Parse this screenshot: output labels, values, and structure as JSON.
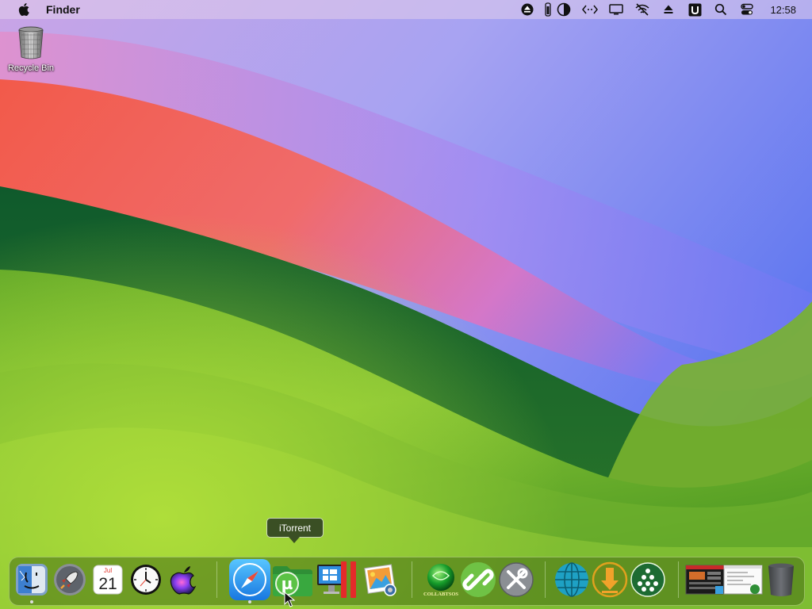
{
  "menubar": {
    "app_name": "Finder",
    "clock": "12:58",
    "status_icons": [
      "eject-icon",
      "battery-icon",
      "contrast-icon",
      "code-icon",
      "display-icon",
      "wifi-off-icon",
      "eject-icon",
      "utility-icon",
      "search-icon",
      "control-center-icon"
    ]
  },
  "desktop": {
    "recycle_bin_label": "Recycle Bin"
  },
  "dock": {
    "tooltip": "iTorrent",
    "items": [
      "finder",
      "launchpad",
      "calendar",
      "clock",
      "siri",
      "safari",
      "utorrent",
      "parallels",
      "preview",
      "collabtsos",
      "link",
      "system-tools",
      "globe",
      "downloader",
      "dots",
      "window-thumb-1",
      "window-thumb-2",
      "trash"
    ],
    "calendar": {
      "month": "Jul",
      "day": "21"
    },
    "collab_label": "COLLABTSOS"
  },
  "colors": {
    "accent": "#2b9cf0",
    "dock_tint": "#466e14",
    "tooltip_bg": "#3a4f24"
  }
}
